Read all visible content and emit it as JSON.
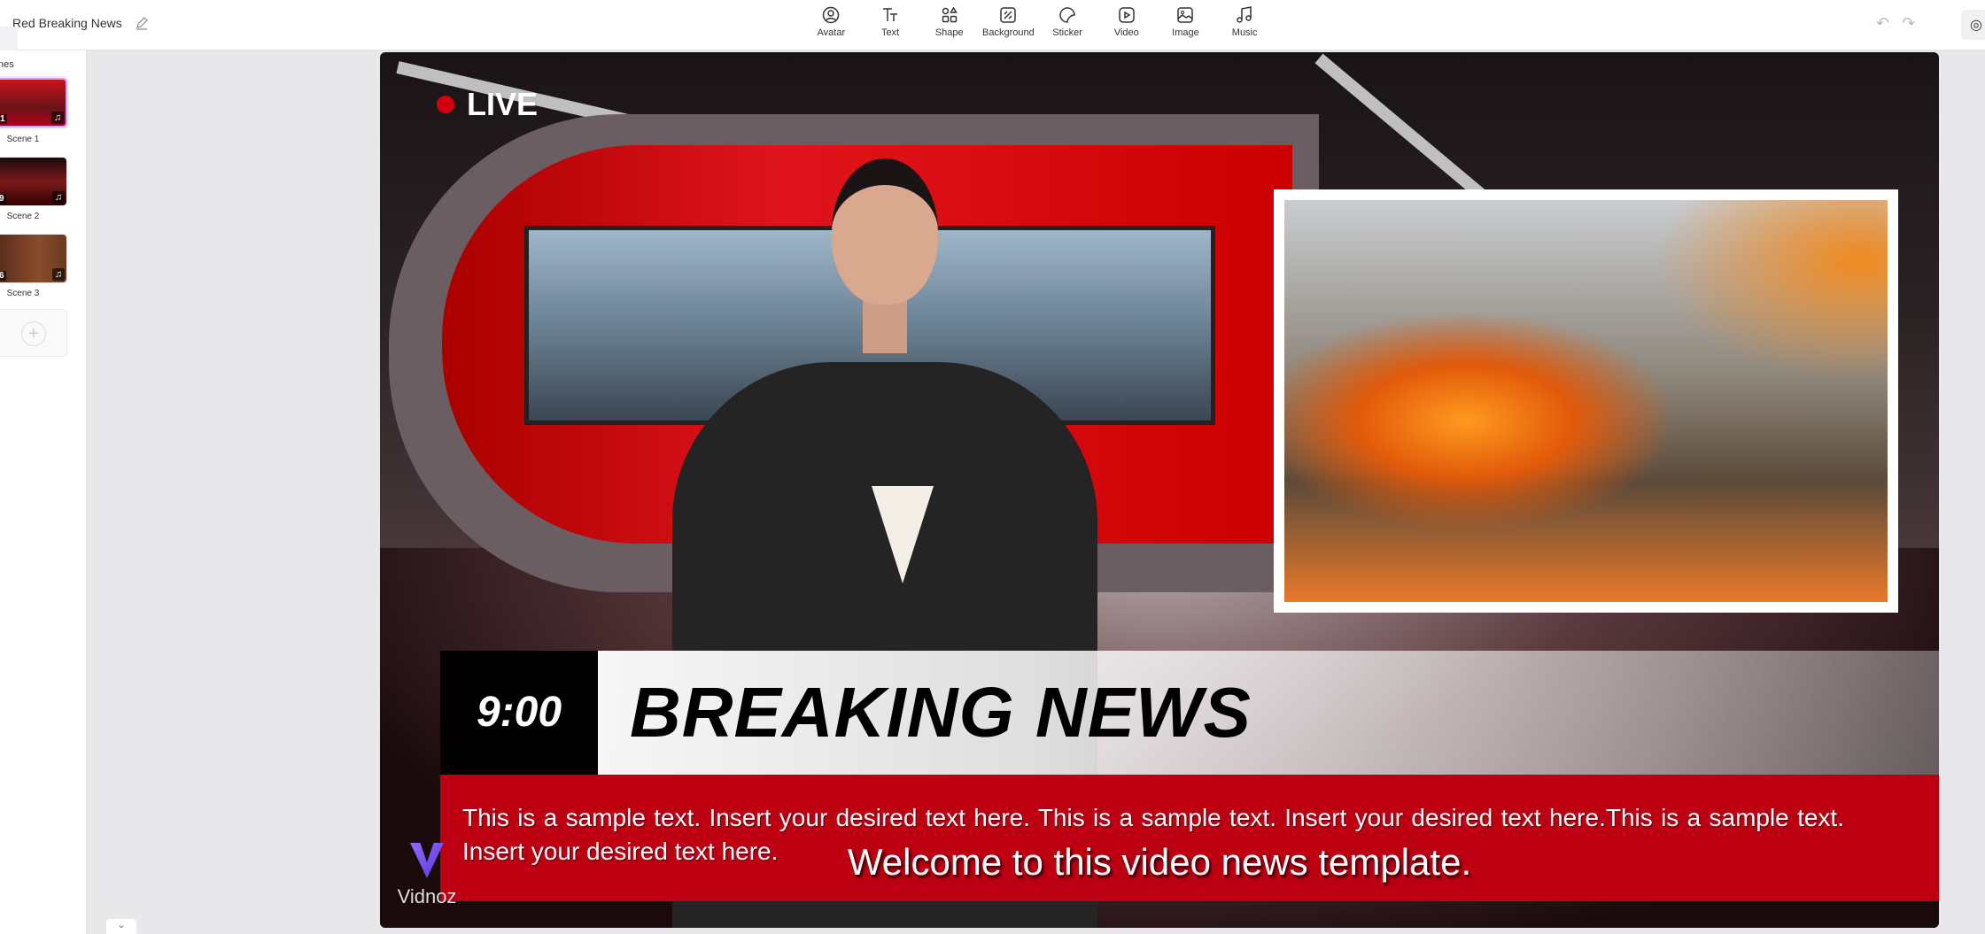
{
  "header": {
    "project_title": "Red Breaking News"
  },
  "toolbar": {
    "items": [
      {
        "label": "Avatar",
        "icon": "avatar-icon"
      },
      {
        "label": "Text",
        "icon": "text-icon"
      },
      {
        "label": "Shape",
        "icon": "shape-icon"
      },
      {
        "label": "Background",
        "icon": "background-icon"
      },
      {
        "label": "Sticker",
        "icon": "sticker-icon"
      },
      {
        "label": "Video",
        "icon": "video-icon"
      },
      {
        "label": "Image",
        "icon": "image-icon"
      },
      {
        "label": "Music",
        "icon": "music-icon"
      }
    ]
  },
  "sidebar": {
    "title": "nes",
    "scenes": [
      {
        "label": "Scene 1",
        "duration": "1",
        "selected": true
      },
      {
        "label": "Scene 2",
        "duration": "9",
        "selected": false
      },
      {
        "label": "Scene 3",
        "duration": "6",
        "selected": false
      }
    ]
  },
  "canvas": {
    "live_label": "LIVE",
    "time": "9:00",
    "headline": "BREAKING NEWS",
    "ticker_text": "This is a sample text. Insert your desired text here. This is a sample text. Insert your desired text here.This is a sample text. Insert your desired text here.",
    "subtitle": "Welcome to this video news template.",
    "watermark": "Vidnoz"
  },
  "colors": {
    "accent": "#bc0012",
    "live_dot": "#d4000f",
    "selection": "#c9a4f3"
  }
}
